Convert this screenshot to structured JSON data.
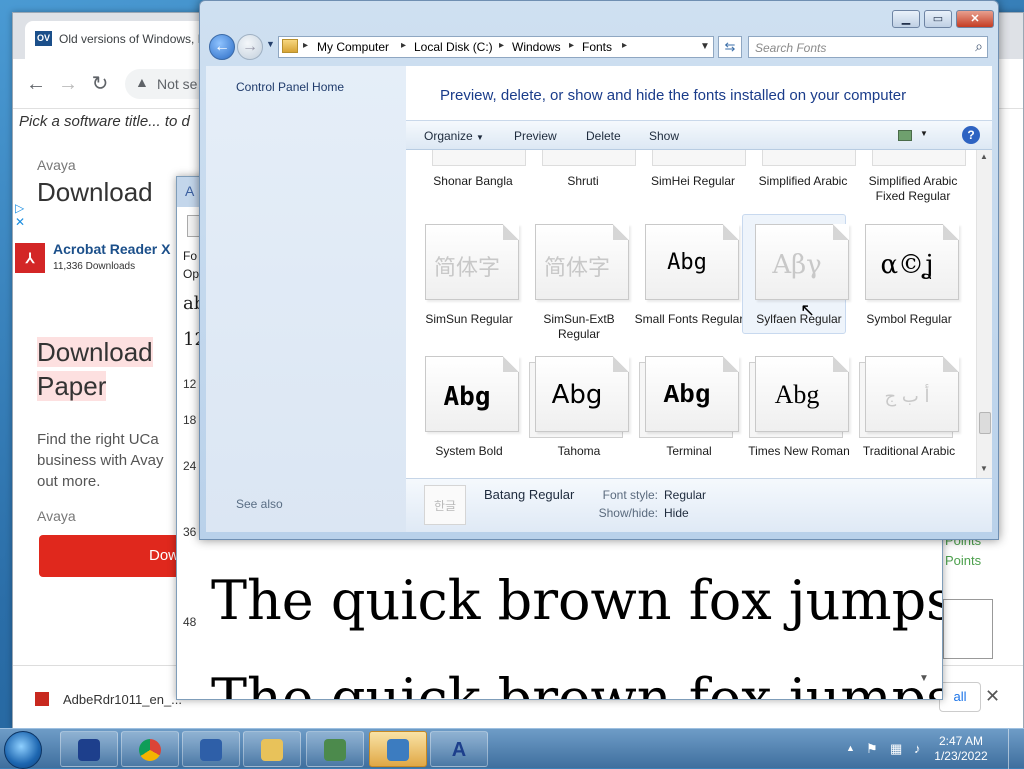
{
  "browser": {
    "tab_title": "Old versions of Windows, M",
    "tab_favicon": "OV",
    "address_prefix": "Not se",
    "page_search_placeholder": "Pick a software title... to d",
    "ad1_label": "Avaya",
    "ad1_heading": "Download",
    "acrobat_title": "Acrobat Reader X",
    "acrobat_downloads": "11,336 Downloads",
    "ad2_heading_line1": "Download",
    "ad2_heading_line2": "Paper",
    "ad2_body": "Find the right UCa business with Avay out more.",
    "ad2_label": "Avaya",
    "ad2_button": "Dow",
    "right_frag1": "Points",
    "right_frag2": "Points",
    "right_frag3": "all",
    "download_file": "AdbeRdr1011_en_..."
  },
  "fontviewer": {
    "header_fragments": [
      "Fo",
      "Op"
    ],
    "sizes": [
      "12",
      "18",
      "24",
      "36",
      "48"
    ],
    "sample_small": "ab",
    "sample_num": "12",
    "sample_text": "The quick brown fox jumps"
  },
  "explorer": {
    "breadcrumb": [
      "My Computer",
      "Local Disk (C:)",
      "Windows",
      "Fonts"
    ],
    "search_placeholder": "Search Fonts",
    "control_panel_home": "Control Panel Home",
    "see_also": "See also",
    "heading": "Preview, delete, or show and hide the fonts installed on your computer",
    "commands": {
      "organize": "Organize",
      "preview": "Preview",
      "delete": "Delete",
      "show": "Show"
    },
    "top_row": [
      "Shonar Bangla",
      "Shruti",
      "SimHei Regular",
      "Simplified Arabic",
      "Simplified Arabic Fixed Regular"
    ],
    "fonts": [
      {
        "name": "SimSun Regular",
        "glyph": "简体字",
        "faded": true
      },
      {
        "name": "SimSun-ExtB Regular",
        "glyph": "简体字",
        "faded": true
      },
      {
        "name": "Small Fonts Regular",
        "glyph": "Abg",
        "faded": false
      },
      {
        "name": "Sylfaen Regular",
        "glyph": "Αβγ",
        "faded": true
      },
      {
        "name": "Symbol Regular",
        "glyph": "α©ʝ",
        "faded": false
      },
      {
        "name": "System Bold",
        "glyph": "Abg",
        "faded": false
      },
      {
        "name": "Tahoma",
        "glyph": "Abg",
        "faded": false
      },
      {
        "name": "Terminal",
        "glyph": "Abg",
        "faded": false
      },
      {
        "name": "Times New Roman",
        "glyph": "Abg",
        "faded": false
      },
      {
        "name": "Traditional Arabic",
        "glyph": "أ ب ج",
        "faded": true
      }
    ],
    "details": {
      "thumb_glyph": "한글",
      "font_name": "Batang Regular",
      "font_style_label": "Font style:",
      "font_style_value": "Regular",
      "show_hide_label": "Show/hide:",
      "show_hide_value": "Hide"
    }
  },
  "taskbar": {
    "time": "2:47 AM",
    "date": "1/23/2022"
  }
}
